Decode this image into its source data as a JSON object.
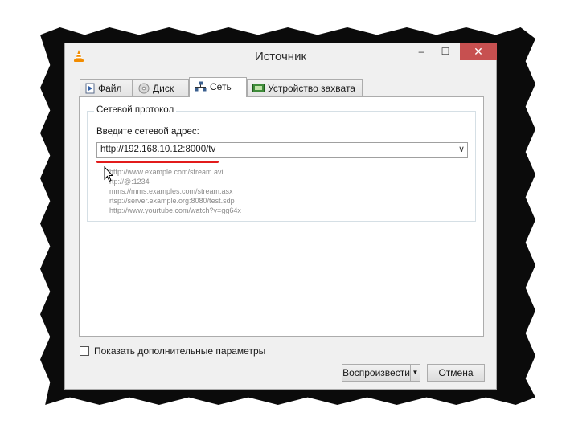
{
  "window": {
    "title": "Источник",
    "controls": {
      "minimize": "–",
      "maximize": "☐",
      "close": "✕"
    }
  },
  "tabs": [
    {
      "label": "Файл",
      "icon": "file-icon",
      "active": false
    },
    {
      "label": "Диск",
      "icon": "disc-icon",
      "active": false
    },
    {
      "label": "Сеть",
      "icon": "network-icon",
      "active": true
    },
    {
      "label": "Устройство захвата",
      "icon": "capture-device-icon",
      "active": false
    }
  ],
  "network": {
    "group_title": "Сетевой протокол",
    "address_label": "Введите сетевой адрес:",
    "address_value": "http://192.168.10.12:8000/tv",
    "examples": [
      "http://www.example.com/stream.avi",
      "rtp://@:1234",
      "mms://mms.examples.com/stream.asx",
      "rtsp://server.example.org:8080/test.sdp",
      "http://www.yourtube.com/watch?v=gg64x"
    ]
  },
  "footer": {
    "show_more_label": "Показать дополнительные параметры",
    "show_more_checked": false,
    "play_label": "Воспроизвести",
    "play_dropdown": "▼",
    "cancel_label": "Отмена"
  },
  "colors": {
    "accent_underline": "#e21b1b",
    "close_button": "#c75050",
    "vlc_orange": "#f28c00"
  }
}
